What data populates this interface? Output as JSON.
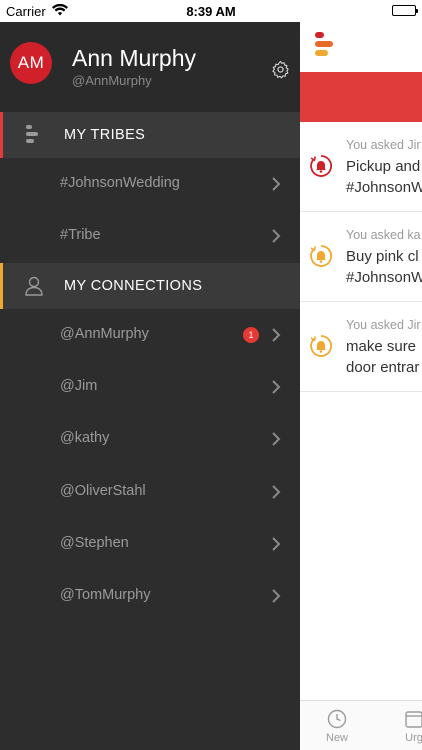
{
  "status_bar": {
    "carrier": "Carrier",
    "time": "8:39 AM"
  },
  "profile": {
    "initials": "AM",
    "name": "Ann Murphy",
    "handle": "@AnnMurphy"
  },
  "tribes_section": {
    "label": "MY TRIBES",
    "accent": "#e03c3c"
  },
  "tribes": [
    {
      "label": "#JohnsonWedding"
    },
    {
      "label": "#Tribe"
    }
  ],
  "connections_section": {
    "label": "MY CONNECTIONS",
    "accent": "#f0a830"
  },
  "connections": [
    {
      "label": "@AnnMurphy",
      "badge": "1"
    },
    {
      "label": "@Jim"
    },
    {
      "label": "@kathy"
    },
    {
      "label": "@OliverStahl"
    },
    {
      "label": "@Stephen"
    },
    {
      "label": "@TomMurphy"
    }
  ],
  "feed": [
    {
      "meta": "You asked Jir",
      "line1": "Pickup and",
      "line2": "#JohnsonW",
      "icon": "overdue-bell-icon",
      "color": "#d0202a"
    },
    {
      "meta": "You asked ka",
      "line1": "Buy pink cl",
      "line2": "#JohnsonW",
      "icon": "pending-bell-icon",
      "color": "#f0a830"
    },
    {
      "meta": "You asked Jir",
      "line1": "make sure",
      "line2": "door entrar",
      "icon": "pending-bell-icon",
      "color": "#f0a830"
    }
  ],
  "tabbar": {
    "new_label": "New",
    "urgent_label": "Urg"
  },
  "colors": {
    "drawer_bg": "#2d2d2d",
    "header_bg": "#3a3a3a",
    "red": "#e03c3c",
    "orange": "#f0a830"
  }
}
